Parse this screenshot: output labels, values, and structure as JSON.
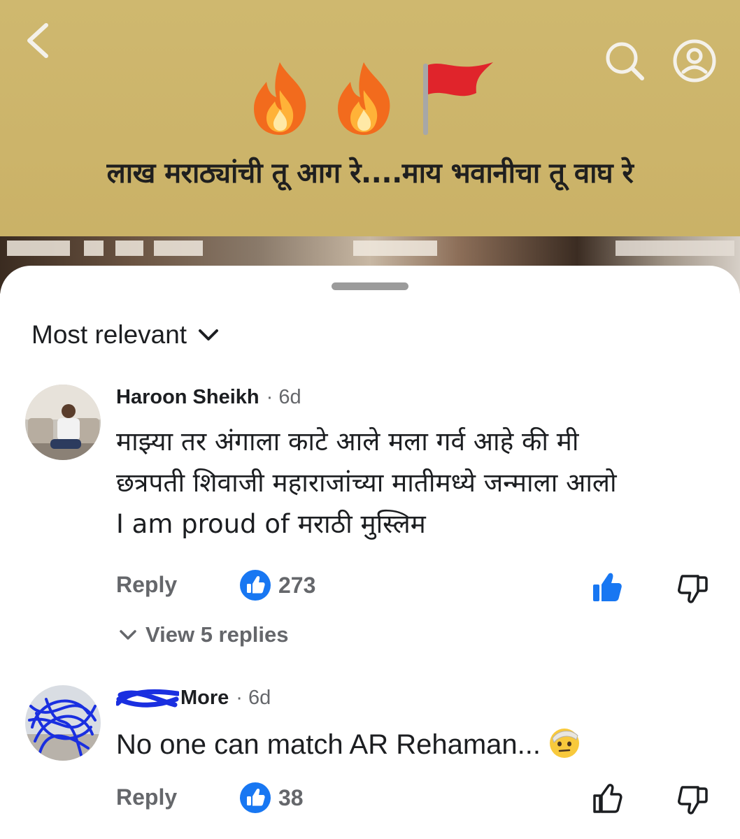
{
  "video": {
    "caption": "लाख मराठ्यांची तू आग रे....माय भवानीचा तू वाघ रे",
    "emojis": [
      "fire-emoji",
      "fire-emoji",
      "red-flag-emoji"
    ]
  },
  "top_bar": {
    "back_icon": "chevron-left-icon",
    "search_icon": "search-icon",
    "profile_icon": "profile-icon"
  },
  "sheet": {
    "sort_label": "Most relevant",
    "comments": [
      {
        "author": "Haroon Sheikh",
        "time": "· 6d",
        "text_lines": [
          "माझ्या तर अंगाला काटे आले मला गर्व आहे की मी",
          "छत्रपती शिवाजी महाराजांच्या मातीमध्ये जन्माला आलो",
          "I am proud of मराठी मुस्लिम"
        ],
        "reply_label": "Reply",
        "likes": "273",
        "liked": true,
        "view_replies": "View 5 replies"
      },
      {
        "author": "More",
        "time": "· 6d",
        "text": "No one can match AR Rehaman...",
        "emoji": "face-with-bandage-emoji",
        "reply_label": "Reply",
        "likes": "38",
        "liked": false
      }
    ]
  },
  "colors": {
    "video_bg": "#cfb86f",
    "fb_blue": "#1877f2",
    "text_primary": "#1c1e21",
    "text_secondary": "#65676b",
    "scribble_blue": "#1a2fe0"
  }
}
